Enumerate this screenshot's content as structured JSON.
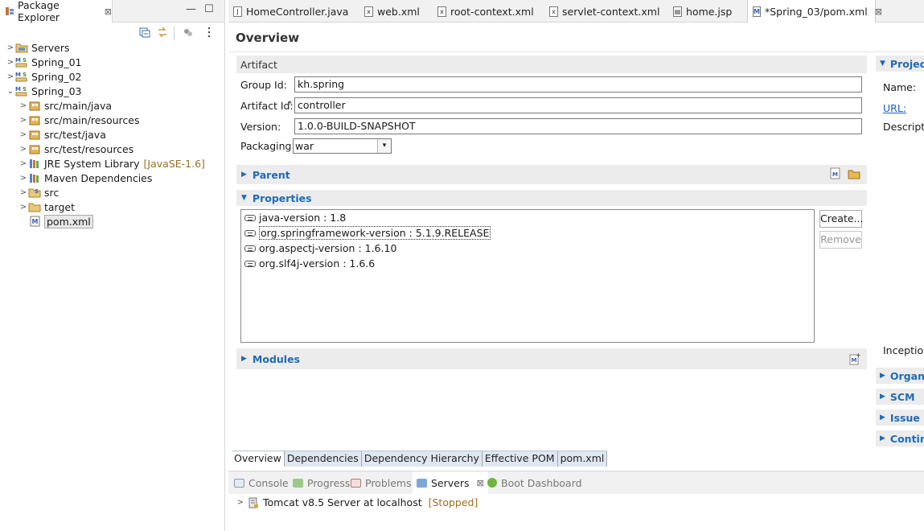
{
  "explorer": {
    "title": "Package Explorer",
    "tree": [
      {
        "label": "Servers",
        "icon": "folder-icon",
        "expanded": false
      },
      {
        "label": "Spring_01",
        "icon": "maven-project-icon",
        "expanded": false
      },
      {
        "label": "Spring_02",
        "icon": "maven-project-icon",
        "expanded": false
      },
      {
        "label": "Spring_03",
        "icon": "maven-project-icon",
        "expanded": true
      },
      {
        "label": "src/main/java",
        "icon": "source-folder-icon"
      },
      {
        "label": "src/main/resources",
        "icon": "source-folder-icon"
      },
      {
        "label": "src/test/java",
        "icon": "source-folder-icon"
      },
      {
        "label": "src/test/resources",
        "icon": "source-folder-icon"
      },
      {
        "label": "JRE System Library",
        "decoration": "[JavaSE-1.6]",
        "icon": "library-icon"
      },
      {
        "label": "Maven Dependencies",
        "icon": "library-icon"
      },
      {
        "label": "src",
        "icon": "source-folder-icon"
      },
      {
        "label": "target",
        "icon": "folder-icon"
      },
      {
        "label": "pom.xml",
        "icon": "maven-file-icon"
      }
    ]
  },
  "editor_tabs": [
    {
      "label": "HomeController.java",
      "icon": "java-file-icon"
    },
    {
      "label": "web.xml",
      "icon": "xml-file-icon"
    },
    {
      "label": "root-context.xml",
      "icon": "xml-file-icon"
    },
    {
      "label": "servlet-context.xml",
      "icon": "xml-file-icon"
    },
    {
      "label": "home.jsp",
      "icon": "jsp-file-icon"
    },
    {
      "label": "*Spring_03/pom.xml",
      "icon": "maven-file-icon",
      "active": true
    }
  ],
  "overview": {
    "title": "Overview",
    "artifact": {
      "header": "Artifact",
      "group_id_label": "Group Id:",
      "group_id": "kh.spring",
      "artifact_id_label": "Artifact Id:",
      "artifact_id": "controller",
      "version_label": "Version:",
      "version": "1.0.0-BUILD-SNAPSHOT",
      "packaging_label": "Packaging:",
      "packaging": "war"
    },
    "parent_header": "Parent",
    "properties_header": "Properties",
    "properties": [
      {
        "label": "java-version : 1.8"
      },
      {
        "label": "org.springframework-version : 5.1.9.RELEASE"
      },
      {
        "label": "org.aspectj-version : 1.6.10"
      },
      {
        "label": "org.slf4j-version : 1.6.6"
      }
    ],
    "create_button": "Create...",
    "remove_button": "Remove",
    "modules_header": "Modules",
    "project": {
      "header": "Project",
      "name_label": "Name:",
      "url_label": "URL:",
      "description_label": "Descriptio",
      "inception_label": "Inception"
    },
    "side_sections": [
      "Organiz",
      "SCM",
      "Issue M",
      "Continu"
    ]
  },
  "page_tabs": [
    "Overview",
    "Dependencies",
    "Dependency Hierarchy",
    "Effective POM",
    "pom.xml"
  ],
  "bottom": {
    "tabs": [
      {
        "label": "Console",
        "icon": "console-icon"
      },
      {
        "label": "Progress",
        "icon": "progress-icon"
      },
      {
        "label": "Problems",
        "icon": "problems-icon"
      },
      {
        "label": "Servers",
        "icon": "servers-icon",
        "active": true
      },
      {
        "label": "Boot Dashboard",
        "icon": "boot-dashboard-icon"
      }
    ],
    "server": {
      "label": "Tomcat v8.5 Server at localhost",
      "status": "[Stopped]"
    }
  },
  "colors": {
    "accent": "#1f6bb5",
    "decoration": "#9b6f21",
    "section_bg": "#ececec"
  }
}
